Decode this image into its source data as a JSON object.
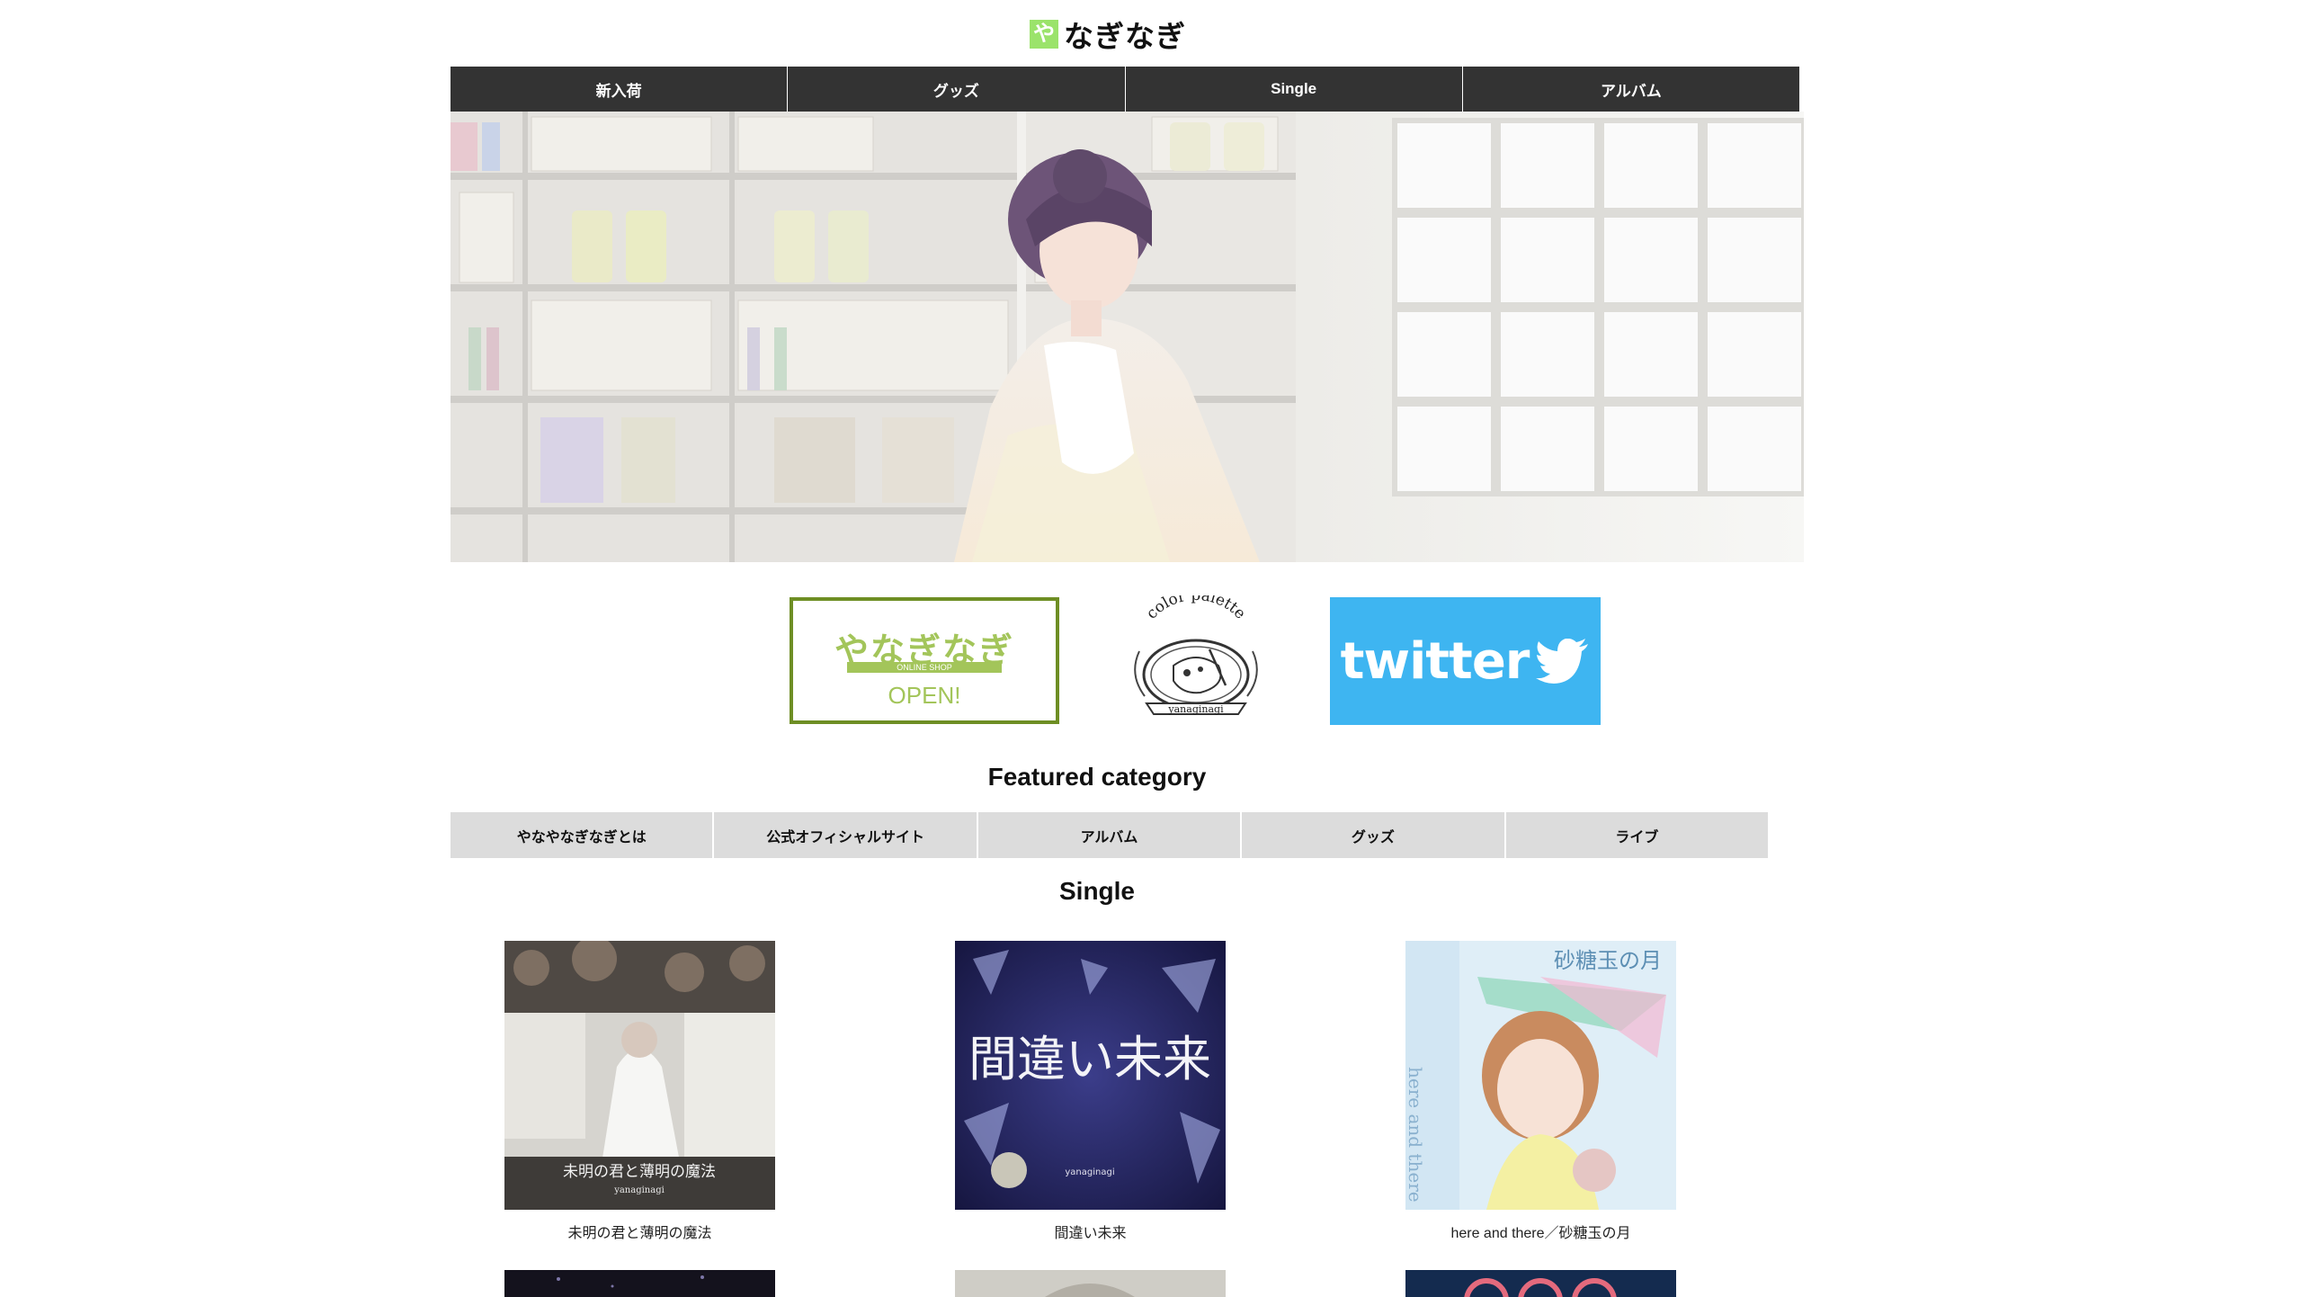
{
  "header": {
    "logo_mark": "や",
    "site_title": "なぎなぎ"
  },
  "global_nav": [
    "新入荷",
    "グッズ",
    "Single",
    "アルバム"
  ],
  "banners": {
    "shop": {
      "title": "やなぎなぎ",
      "subtitle": "ONLINE SHOP",
      "status": "OPEN!"
    },
    "palette": {
      "arc_text": "color palette",
      "bottom_text": "yanaginagi"
    },
    "twitter": {
      "text": "twitter"
    }
  },
  "featured": {
    "heading": "Featured category",
    "items": [
      "やなやなぎなぎとは",
      "公式オフィシャルサイト",
      "アルバム",
      "グッズ",
      "ライブ"
    ]
  },
  "singles": {
    "heading": "Single",
    "items": [
      {
        "title": "未明の君と薄明の魔法",
        "cover_text": "未明の君と薄明の魔法",
        "cover_sub": "yanaginagi"
      },
      {
        "title": "間違い未来",
        "cover_text": "間違い未来",
        "cover_sub": "yanaginagi"
      },
      {
        "title": "here and there／砂糖玉の月",
        "cover_text": "砂糖玉の月",
        "cover_sub": "here and there"
      }
    ]
  },
  "colors": {
    "nav_bg": "#333333",
    "category_bg": "#dcdcdc",
    "shop_green": "#a3c55a",
    "shop_border": "#6e8e24",
    "twitter_blue": "#3eb5f1",
    "logo_green": "#9be36b"
  }
}
